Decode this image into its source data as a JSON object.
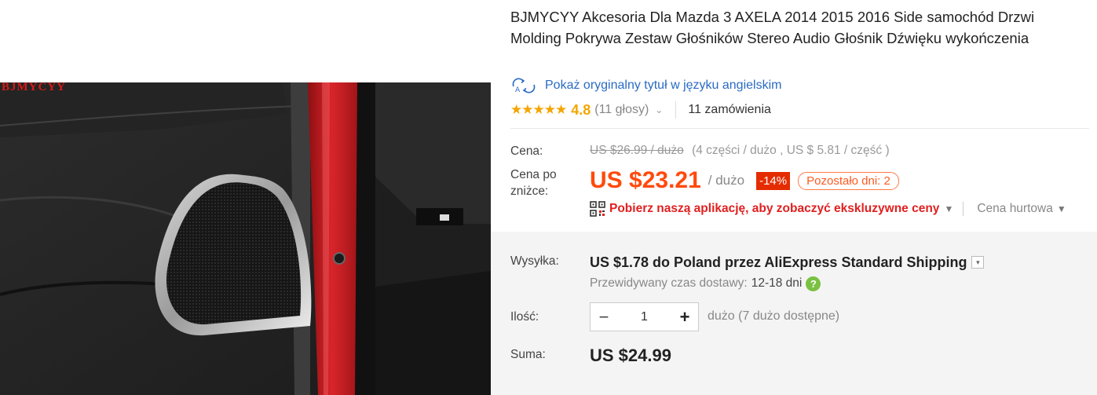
{
  "product": {
    "watermark": "BJMYCYY",
    "title": "BJMYCYY Akcesoria Dla Mazda 3 AXELA 2014 2015 2016 Side samochód Drzwi Molding Pokrywa Zestaw Głośników Stereo Audio Głośnik Dźwięku wykończenia",
    "show_original_title": "Pokaż oryginalny tytuł w języku angielskim",
    "rating": {
      "stars": "★★★★★",
      "score": "4.8",
      "votes": "(11 głosy)",
      "chevron": "⌄",
      "orders": "11 zamówienia"
    }
  },
  "pricing": {
    "price_label": "Cena:",
    "original_price": "US $26.99 / dużo",
    "original_price_detail": "(4 części / dużo , US $ 5.81 / część )",
    "discount_label": "Cena po zniżce:",
    "discount_price": "US $23.21",
    "per_unit": "/ dużo",
    "discount_badge": "-14%",
    "days_left": "Pozostało dni: 2",
    "app_promo": "Pobierz naszą aplikację, aby zobaczyć ekskluzywne ceny",
    "app_caret": "▼",
    "bulk_price": "Cena hurtowa",
    "bulk_caret": "▼"
  },
  "shipping": {
    "label": "Wysyłka:",
    "line": "US $1.78 do Poland przez AliExpress Standard Shipping",
    "dropdown_icon": "▾",
    "delivery_label": "Przewidywany czas dostawy:",
    "delivery_value": "12-18 dni",
    "help_icon": "?"
  },
  "quantity": {
    "label": "Ilość:",
    "minus": "−",
    "value": "1",
    "plus": "+",
    "note": "dużo (7 dużo dostępne)"
  },
  "total": {
    "label": "Suma:",
    "value": "US $24.99"
  },
  "icons": {
    "translate": "translate-icon",
    "qr": "qr-code-icon",
    "help": "help-icon"
  },
  "colors": {
    "price": "#ff4a0c",
    "discount_badge": "#e52c00",
    "link": "#2a6bc3",
    "stars": "#f4a500",
    "promo": "#e02020",
    "help": "#7ac142"
  }
}
